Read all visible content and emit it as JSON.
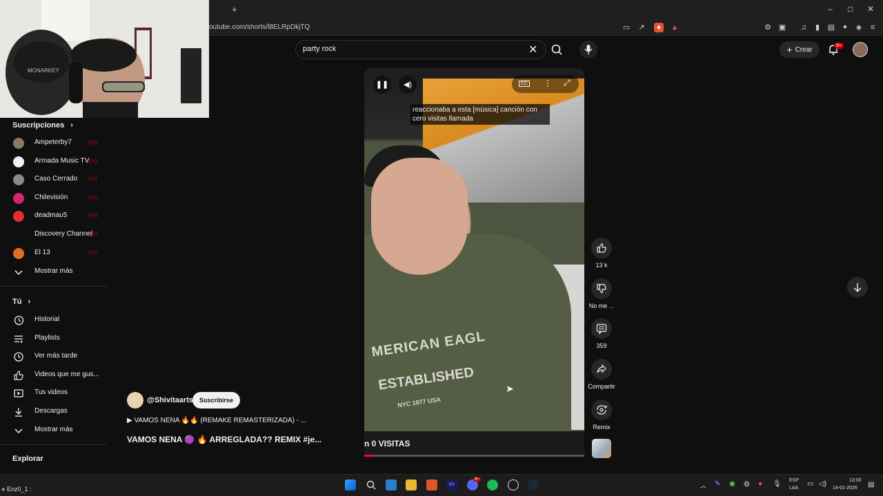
{
  "browser": {
    "new_tab_symbol": "+",
    "url": "outube.com/shorts/l8ELRpDkjTQ",
    "window_controls": [
      "–",
      "□",
      "✕"
    ]
  },
  "header": {
    "search_query": "party rock",
    "create_label": "Crear",
    "notifications_badge": "9+"
  },
  "sidebar": {
    "subscriptions_title": "Suscripciones",
    "subscriptions": [
      {
        "name": "Ampeterby7",
        "color": "#8a7a6a"
      },
      {
        "name": "Armada Music TV",
        "color": "#f1f1f1"
      },
      {
        "name": "Caso Cerrado",
        "color": "#8a8a8a"
      },
      {
        "name": "Chilevisión",
        "color": "#d6246e"
      },
      {
        "name": "deadmau5",
        "color": "#e03030"
      },
      {
        "name": "Discovery Channel",
        "color": "#0f0f0f"
      },
      {
        "name": "El 13",
        "color": "#e07020"
      }
    ],
    "show_more_1": "Mostrar más",
    "you_title": "Tú",
    "you_items": [
      {
        "name": "Historial",
        "icon": "history-icon"
      },
      {
        "name": "Playlists",
        "icon": "playlists-icon"
      },
      {
        "name": "Ver más tarde",
        "icon": "watch-later-icon"
      },
      {
        "name": "Videos que me gus...",
        "icon": "like-icon"
      },
      {
        "name": "Tus videos",
        "icon": "your-videos-icon"
      },
      {
        "name": "Descargas",
        "icon": "download-icon"
      }
    ],
    "show_more_2": "Mostrar más",
    "explore_title": "Explorar"
  },
  "video": {
    "caption": "reaccionaba a esta [música] canción con cero visitas llamada",
    "title_fragment": "n 0 VISITAS",
    "shirt_text_1": "MERICAN EAGL",
    "shirt_text_2": "ESTABLISHED",
    "shirt_text_3": "NYC 1977 USA",
    "cc_label": "CC",
    "progress": 0.04
  },
  "actions": {
    "likes": "13 k",
    "dislike_label": "No me ...",
    "comments": "359",
    "share_label": "Compartir",
    "remix_label": "Remix"
  },
  "channel": {
    "handle": "@Shivitaarts",
    "subscribe_label": "Suscribirse",
    "music_line": "▶  VAMOS NENA 🔥🔥 (REMAKE REMASTERIZADA) - ...",
    "short_title": "VAMOS NENA 🟣 🔥 ARREGLADA?? REMIX #je..."
  },
  "taskbar": {
    "status_left": "Enz0_1 :",
    "lang": "ESP",
    "lang_sub": "LAA",
    "time": "13:00",
    "date": "14-01-2026",
    "spotify_badge": "9+"
  }
}
